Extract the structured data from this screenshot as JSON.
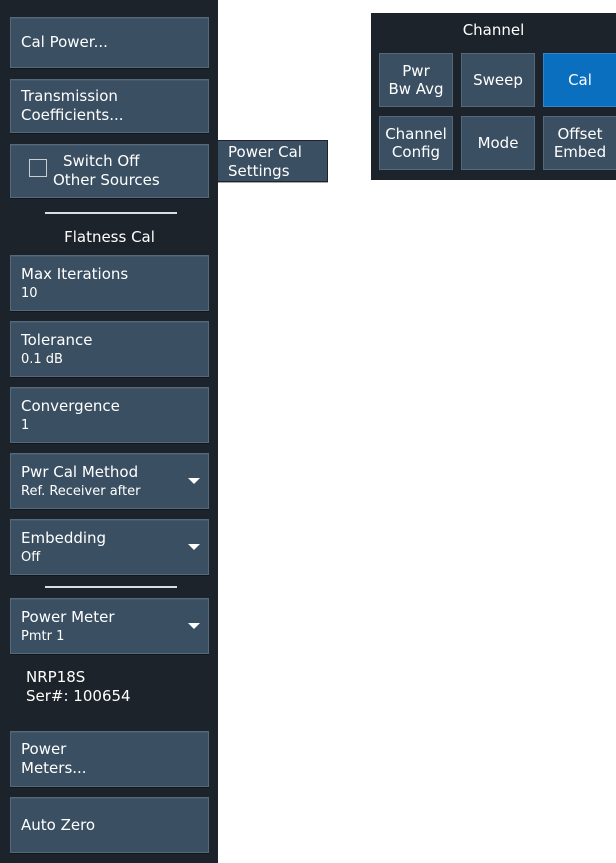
{
  "sidebar": {
    "cal_power": "Cal Power...",
    "transmission": [
      "Transmission",
      "Coefficients..."
    ],
    "switch_off": [
      "Switch Off",
      "Other Sources"
    ],
    "flatness_title": "Flatness Cal",
    "max_iterations": {
      "label": "Max Iterations",
      "value": "10"
    },
    "tolerance": {
      "label": "Tolerance",
      "value": "0.1 dB"
    },
    "convergence": {
      "label": "Convergence",
      "value": "1"
    },
    "pwr_cal_method": {
      "label": "Pwr Cal Method",
      "value": "Ref. Receiver after"
    },
    "embedding": {
      "label": "Embedding",
      "value": "Off"
    },
    "power_meter": {
      "label": "Power Meter",
      "value": "Pmtr 1"
    },
    "meter_info": {
      "model": "NRP18S",
      "serial": "Ser#: 100654"
    },
    "power_meters": [
      "Power",
      "Meters..."
    ],
    "auto_zero": "Auto Zero"
  },
  "flyout": {
    "lines": [
      "Power Cal",
      "Settings"
    ]
  },
  "channel": {
    "title": "Channel",
    "buttons": [
      {
        "lines": [
          "Pwr",
          "Bw Avg"
        ]
      },
      {
        "lines": [
          "Sweep"
        ]
      },
      {
        "lines": [
          "Cal"
        ]
      },
      {
        "lines": [
          "Channel",
          "Config"
        ]
      },
      {
        "lines": [
          "Mode"
        ]
      },
      {
        "lines": [
          "Offset",
          "Embed"
        ]
      }
    ]
  },
  "colors": {
    "panel_bg": "#1c232a",
    "button_bg": "#3b4f62",
    "active": "#0b6fc0"
  }
}
